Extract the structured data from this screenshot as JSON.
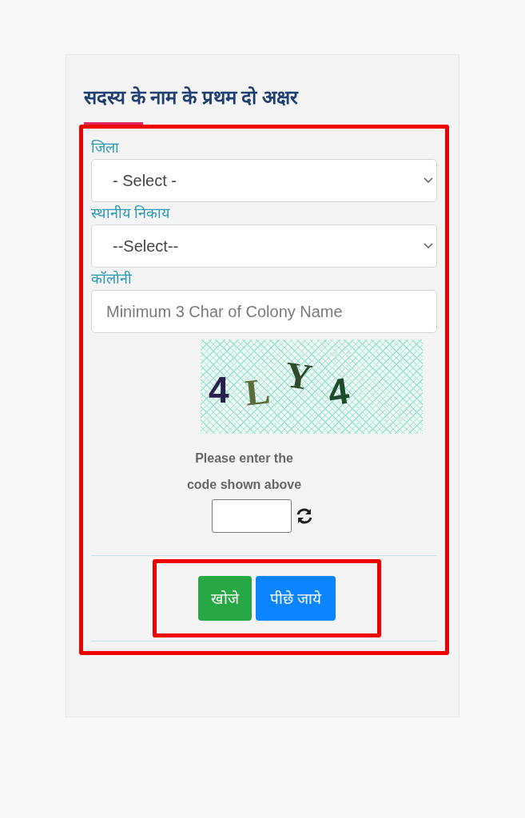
{
  "heading": "सदस्य के नाम के प्रथम दो अक्षर",
  "fields": [
    {
      "kind": "select",
      "label": "जिला",
      "value": "- Select -"
    },
    {
      "kind": "select",
      "label": "स्थानीय निकाय",
      "value": "--Select--"
    },
    {
      "kind": "text",
      "label": "कॉलोनी",
      "placeholder": "Minimum 3 Char of Colony Name"
    }
  ],
  "captcha": {
    "characters": [
      {
        "char": "4",
        "color": "#2a1f4f"
      },
      {
        "char": "L",
        "color": "#5b6b3a"
      },
      {
        "char": "Y",
        "color": "#2f4a2a"
      },
      {
        "char": "4",
        "color": "#1f4a2c"
      }
    ],
    "prompt_lines": [
      "Please enter the",
      "code shown above"
    ]
  },
  "buttons": [
    {
      "kind": "search",
      "label": "खोजे"
    },
    {
      "kind": "back",
      "label": "पीछे जाये"
    }
  ]
}
